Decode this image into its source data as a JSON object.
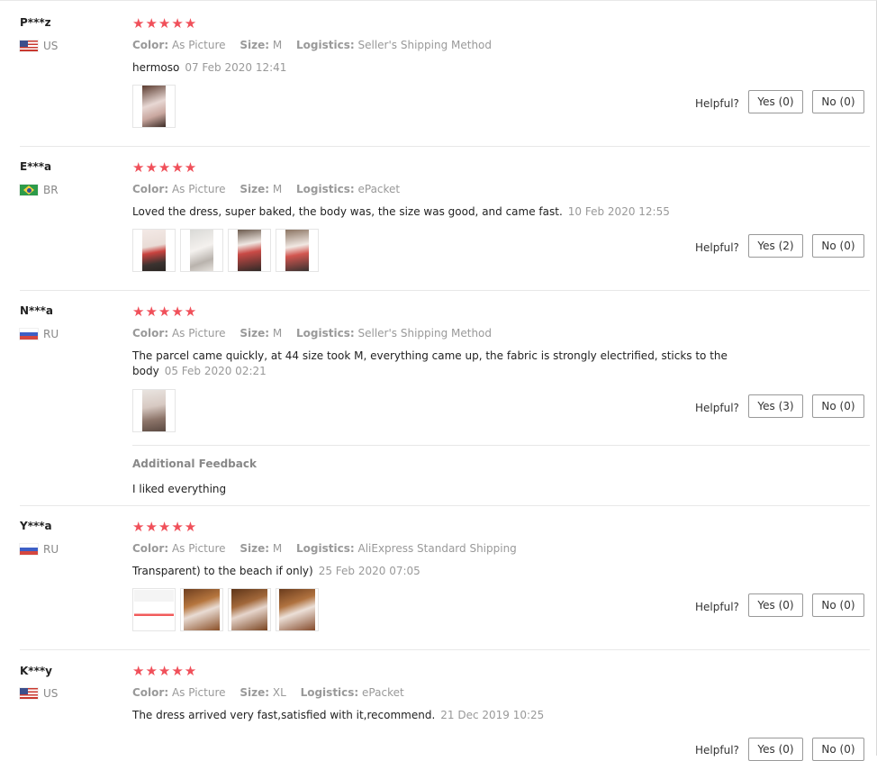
{
  "labels": {
    "color": "Color:",
    "size": "Size:",
    "logistics": "Logistics:",
    "helpful": "Helpful?",
    "additional_feedback": "Additional Feedback"
  },
  "stars_text": "★★★★★",
  "reviews": [
    {
      "user": "P***z",
      "country": "US",
      "flag": "us-flag-icon",
      "color": "As Picture",
      "size": "M",
      "logistics": "Seller's Shipping Method",
      "text": "hermoso",
      "date": "07 Feb 2020 12:41",
      "yes": "Yes (0)",
      "no": "No (0)"
    },
    {
      "user": "E***a",
      "country": "BR",
      "flag": "br-flag-icon",
      "color": "As Picture",
      "size": "M",
      "logistics": "ePacket",
      "text": "Loved the dress, super baked, the body was, the size was good, and came fast.",
      "date": "10 Feb 2020 12:55",
      "yes": "Yes (2)",
      "no": "No (0)"
    },
    {
      "user": "N***a",
      "country": "RU",
      "flag": "ru-flag-icon",
      "color": "As Picture",
      "size": "M",
      "logistics": "Seller's Shipping Method",
      "text": "The parcel came quickly, at 44 size took M, everything came up, the fabric is strongly electrified, sticks to the body",
      "date": "05 Feb 2020 02:21",
      "yes": "Yes (3)",
      "no": "No (0)",
      "additional": "I liked everything"
    },
    {
      "user": "Y***a",
      "country": "RU",
      "flag": "ru-flag-icon",
      "color": "As Picture",
      "size": "M",
      "logistics": "AliExpress Standard Shipping",
      "text": "Transparent) to the beach if only)",
      "date": "25 Feb 2020 07:05",
      "yes": "Yes (0)",
      "no": "No (0)"
    },
    {
      "user": "K***y",
      "country": "US",
      "flag": "us-flag-icon",
      "color": "As Picture",
      "size": "XL",
      "logistics": "ePacket",
      "text": "The dress arrived very fast,satisfied with it,recommend.",
      "date": "21 Dec 2019 10:25",
      "yes": "Yes (0)",
      "no": "No (0)"
    }
  ]
}
